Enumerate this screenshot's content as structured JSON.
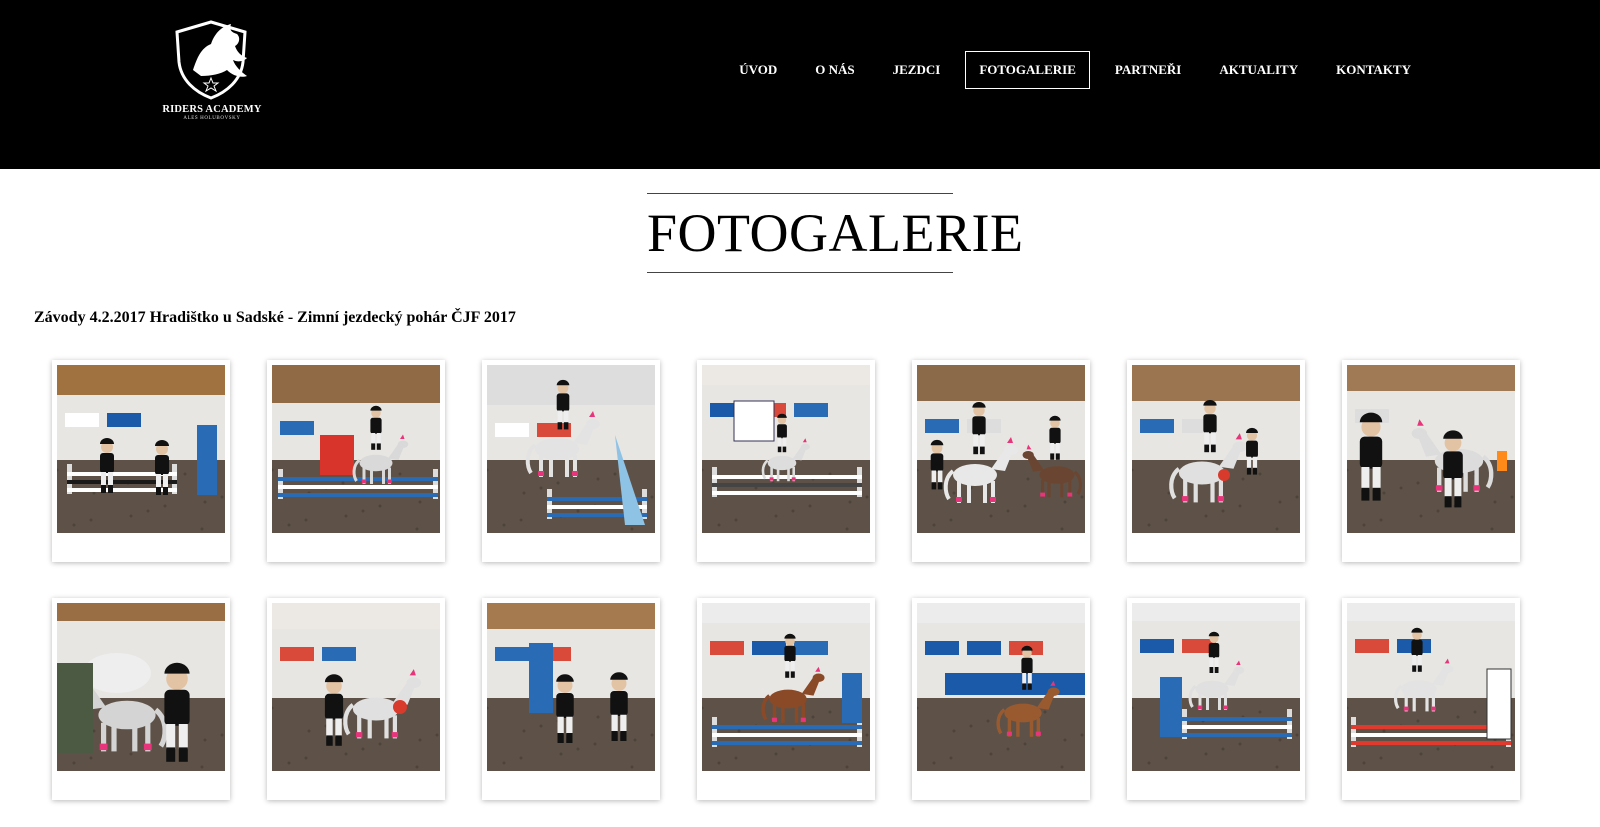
{
  "brand": {
    "name": "RIDERS ACADEMY",
    "subtitle": "ALEŠ HOLUBOVSKÝ",
    "logo_icon": "horse-shield-logo"
  },
  "nav": {
    "items": [
      {
        "label": "ÚVOD",
        "active": false
      },
      {
        "label": "O NÁS",
        "active": false
      },
      {
        "label": "JEZDCI",
        "active": false
      },
      {
        "label": "FOTOGALERIE",
        "active": true
      },
      {
        "label": "PARTNEŘI",
        "active": false
      },
      {
        "label": "AKTUALITY",
        "active": false
      },
      {
        "label": "KONTAKTY",
        "active": false
      }
    ]
  },
  "page": {
    "title": "FOTOGALERIE"
  },
  "album": {
    "title": "Závody 4.2.2017 Hradištko u Sadské - Zimní jezdecký pohár ČJF 2017",
    "photos": [
      {
        "scene": "arena-wide"
      },
      {
        "scene": "jump-red-truck"
      },
      {
        "scene": "pony-jump-close"
      },
      {
        "scene": "arena-banners"
      },
      {
        "scene": "ponies-walking"
      },
      {
        "scene": "pony-rosette"
      },
      {
        "scene": "pony-steam"
      },
      {
        "scene": "pony-close-steam"
      },
      {
        "scene": "girl-leading-pony"
      },
      {
        "scene": "two-riders"
      },
      {
        "scene": "pony-jump-blue"
      },
      {
        "scene": "pony-nutrihorse"
      },
      {
        "scene": "pony-jump-white"
      },
      {
        "scene": "pony-jump-red"
      }
    ]
  },
  "colors": {
    "header_bg": "#000000",
    "nav_text": "#ffffff",
    "accent_pink": "#e8347a"
  }
}
